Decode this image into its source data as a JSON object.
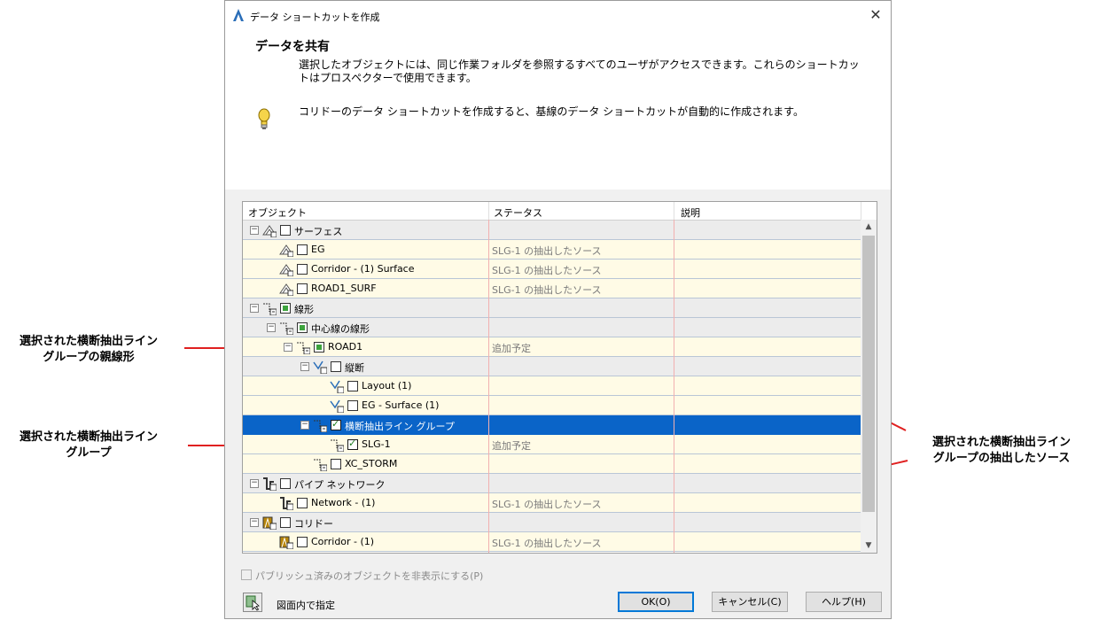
{
  "window": {
    "title": "データ ショートカットを作成",
    "close_glyph": "✕"
  },
  "header": {
    "heading": "データを共有",
    "description": "選択したオブジェクトには、同じ作業フォルダを参照するすべてのユーザがアクセスできます。これらのショートカットはプロスペクターで使用できます。",
    "note": "コリドーのデータ ショートカットを作成すると、基線のデータ ショートカットが自動的に作成されます。"
  },
  "tree": {
    "columns": [
      "オブジェクト",
      "ステータス",
      "説明"
    ],
    "rows": [
      {
        "label": "サーフェス",
        "status": "",
        "type": "group"
      },
      {
        "label": "EG",
        "status": "SLG-1 の抽出したソース",
        "type": "item"
      },
      {
        "label": "Corridor - (1) Surface",
        "status": "SLG-1 の抽出したソース",
        "type": "item"
      },
      {
        "label": "ROAD1_SURF",
        "status": "SLG-1 の抽出したソース",
        "type": "item"
      },
      {
        "label": "線形",
        "status": "",
        "type": "group"
      },
      {
        "label": "中心線の線形",
        "status": "",
        "type": "group"
      },
      {
        "label": "ROAD1",
        "status": "追加予定",
        "type": "item"
      },
      {
        "label": "縦断",
        "status": "",
        "type": "group"
      },
      {
        "label": "Layout (1)",
        "status": "",
        "type": "item"
      },
      {
        "label": "EG - Surface (1)",
        "status": "",
        "type": "item"
      },
      {
        "label": "横断抽出ライン グループ",
        "status": "",
        "type": "selected"
      },
      {
        "label": "SLG-1",
        "status": "追加予定",
        "type": "item"
      },
      {
        "label": "XC_STORM",
        "status": "",
        "type": "item"
      },
      {
        "label": "パイプ ネットワーク",
        "status": "",
        "type": "group"
      },
      {
        "label": "Network - (1)",
        "status": "SLG-1 の抽出したソース",
        "type": "item"
      },
      {
        "label": "コリドー",
        "status": "",
        "type": "group"
      },
      {
        "label": "Corridor - (1)",
        "status": "SLG-1 の抽出したソース",
        "type": "item"
      }
    ]
  },
  "footer": {
    "hide_published": "パブリッシュ済みのオブジェクトを非表示にする(P)",
    "pick_label": "図面内で指定",
    "ok": "OK(O)",
    "cancel": "キャンセル(C)",
    "help": "ヘルプ(H)"
  },
  "callouts": {
    "parent_alignment": [
      "選択された横断抽出ライン",
      "グループの親線形"
    ],
    "sample_line_group": [
      "選択された横断抽出ライン",
      "グループ"
    ],
    "extracted_source": [
      "選択された横断抽出ライン",
      "グループの抽出したソース"
    ]
  },
  "colors": {
    "accent": "#0a64c8",
    "arrow": "#e02020",
    "row_item": "#fffbe6",
    "row_group": "#ececec"
  }
}
